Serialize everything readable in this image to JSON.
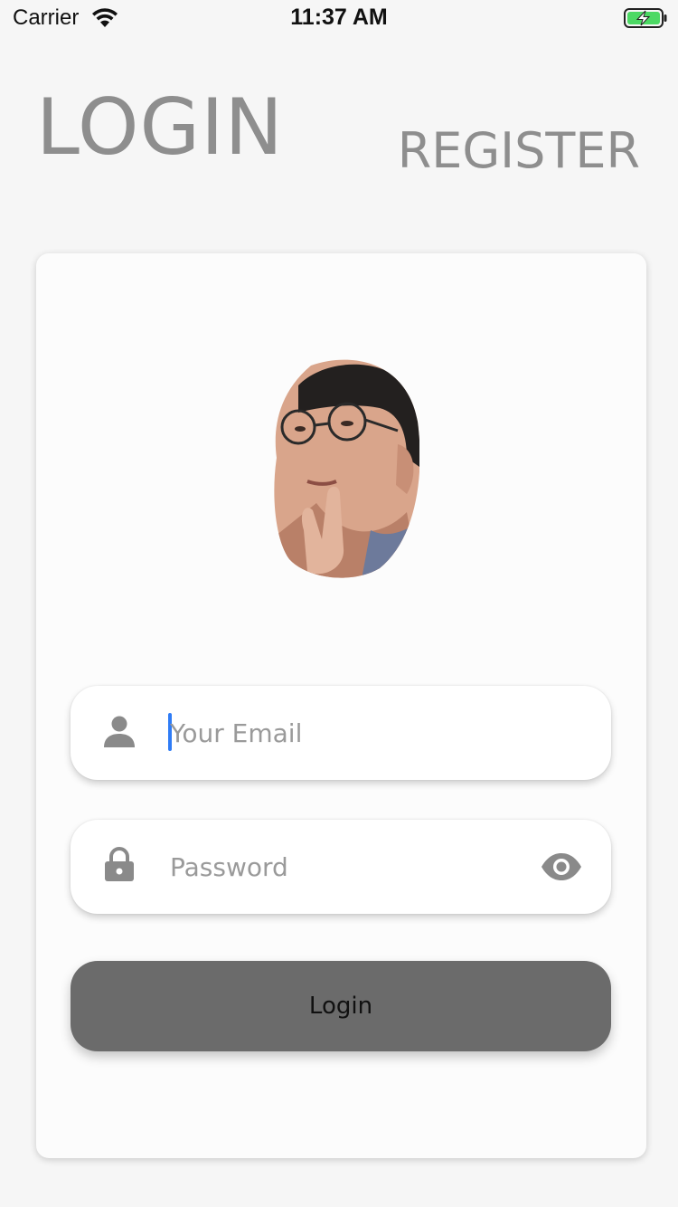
{
  "status_bar": {
    "carrier": "Carrier",
    "time": "11:37 AM",
    "battery_icon": "battery-charging-icon",
    "wifi_icon": "wifi-icon"
  },
  "header": {
    "login_tab": "LOGIN",
    "register_tab": "REGISTER"
  },
  "form": {
    "email": {
      "placeholder": "Your Email",
      "value": "",
      "icon": "person-icon"
    },
    "password": {
      "placeholder": "Password",
      "value": "",
      "icon": "lock-icon",
      "toggle_icon": "eye-icon"
    },
    "submit_label": "Login"
  },
  "colors": {
    "header_text": "#8e8e8e",
    "button_bg": "#6b6b6b",
    "caret": "#2f7cf6",
    "icon": "#8a8a8a",
    "battery": "#4cd964"
  }
}
